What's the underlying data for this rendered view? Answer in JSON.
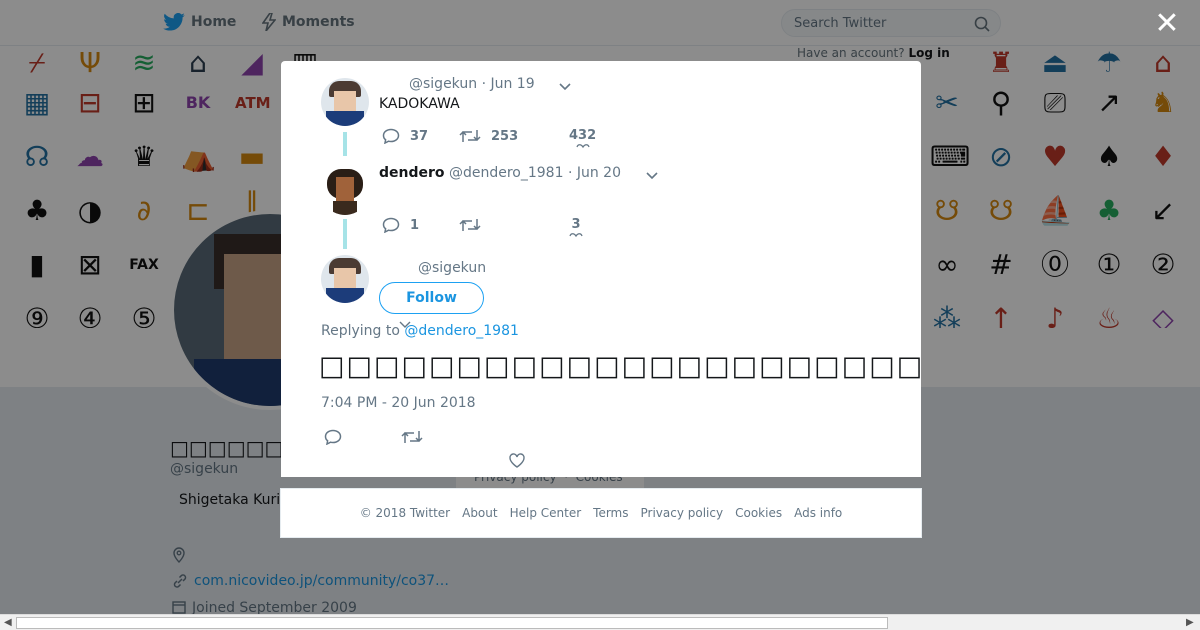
{
  "nav": {
    "home_label": "Home",
    "moments_label": "Moments",
    "search_placeholder": "Search Twitter",
    "have_account_text": "Have an account?",
    "login_label": "Log in"
  },
  "profile": {
    "display_name": "□□□□□□□□□□□",
    "handle": "@sigekun",
    "bio_fragment": "Shigetaka Kuri",
    "link_text": "com.nicovideo.jp/community/co37…",
    "joined_text": "Joined September 2009"
  },
  "background_footer": {
    "privacy": "Privacy policy",
    "cookies": "Cookies"
  },
  "tweet1": {
    "handle": "@sigekun",
    "date": "· Jun 19",
    "text": "KADOKAWA",
    "replies": "37",
    "retweets": "253",
    "likes": "432"
  },
  "tweet2": {
    "name": "dendero",
    "handle": "@dendero_1981",
    "date": "· Jun 20",
    "replies": "1",
    "retweets": "",
    "likes": "3"
  },
  "main_tweet": {
    "handle": "@sigekun",
    "follow_label": "Follow",
    "replying_prefix": "Replying to",
    "replying_to": "@dendero_1981",
    "text": "□□□□□□□□□□□□□□□□□□□□□□□□□□□□□□□□□□□□□□□□□□□□□□□□□□□□□□□",
    "timestamp": "7:04 PM - 20 Jun 2018"
  },
  "footer": {
    "copyright": "© 2018 Twitter",
    "about": "About",
    "help": "Help Center",
    "terms": "Terms",
    "privacy": "Privacy policy",
    "cookies": "Cookies",
    "ads": "Ads info"
  },
  "icons": {
    "twitter_logo": "twitter-bird-icon",
    "moments": "lightning-icon",
    "search": "search-icon",
    "close": "close-icon",
    "reply": "reply-icon",
    "retweet": "retweet-icon",
    "like": "heart-icon",
    "caret": "chevron-down-icon",
    "location": "location-icon",
    "link": "link-icon",
    "calendar": "calendar-icon"
  },
  "colors": {
    "accent": "#1da1f2",
    "link": "#1b95e0",
    "thread_line": "#a6e3e7",
    "text_secondary": "#657786"
  }
}
